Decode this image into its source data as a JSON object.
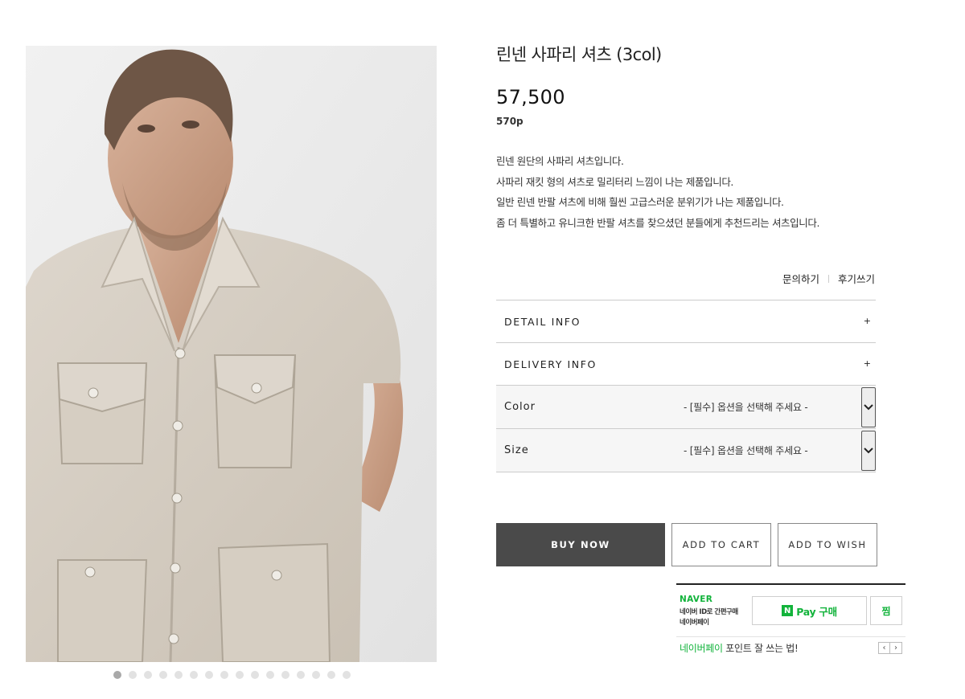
{
  "product": {
    "title": "린넨 사파리 셔츠 (3col)",
    "price": "57,500",
    "points": "570p",
    "description": [
      "린넨 원단의 사파리 셔츠입니다.",
      "사파리 재킷 형의 셔츠로 밀리터리 느낌이 나는 제품입니다.",
      "일반 린넨 반팔 셔츠에 비해 훨씬 고급스러운 분위기가 나는 제품입니다.",
      "좀 더 특별하고 유니크한 반팔 셔츠를 찾으셨던 분들에게 추천드리는 셔츠입니다."
    ]
  },
  "gallery": {
    "total_images": 16,
    "active_index": 0
  },
  "links": {
    "inquiry": "문의하기",
    "review": "후기쓰기"
  },
  "info_sections": [
    {
      "label": "DETAIL INFO",
      "toggle": "+"
    },
    {
      "label": "DELIVERY INFO",
      "toggle": "+"
    }
  ],
  "options": [
    {
      "label": "Color",
      "placeholder": "- [필수] 옵션을 선택해 주세요 -"
    },
    {
      "label": "Size",
      "placeholder": "- [필수] 옵션을 선택해 주세요 -"
    }
  ],
  "buttons": {
    "buy": "BUY NOW",
    "cart": "ADD TO CART",
    "wish": "ADD TO WISH"
  },
  "naver_pay": {
    "brand": "NAVER",
    "sub_line1": "네이버 ID로 간편구매",
    "sub_line2": "네이버페이",
    "pay_logo": "N",
    "pay_button": "Pay 구매",
    "wish_button": "찜",
    "footer_green": "네이버페이",
    "footer_rest": " 포인트 잘 쓰는 법!",
    "prev": "‹",
    "next": "›"
  },
  "colors": {
    "accent_green": "#12b33b",
    "buy_button_bg": "#4a4a4a"
  }
}
